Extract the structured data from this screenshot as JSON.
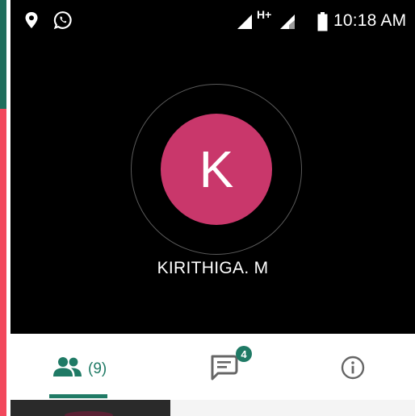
{
  "status_bar": {
    "time": "10:18 AM",
    "network_type": "H+",
    "icons": [
      "location-pin-icon",
      "whatsapp-icon",
      "signal-icon",
      "signal-icon",
      "battery-icon"
    ]
  },
  "call": {
    "avatar_initial": "K",
    "avatar_color": "#c9376b",
    "caller_name": "KIRITHIGA. M"
  },
  "tabs": [
    {
      "id": "participants",
      "icon": "participants-icon",
      "label": "(9)",
      "selected": true
    },
    {
      "id": "chat",
      "icon": "chat-icon",
      "badge": "4"
    },
    {
      "id": "info",
      "icon": "info-icon"
    }
  ],
  "colors": {
    "accent": "#1f7a65",
    "call_background": "#000000",
    "left_strip_top": "#1f6e5c",
    "left_strip_bottom": "#f2485c"
  }
}
